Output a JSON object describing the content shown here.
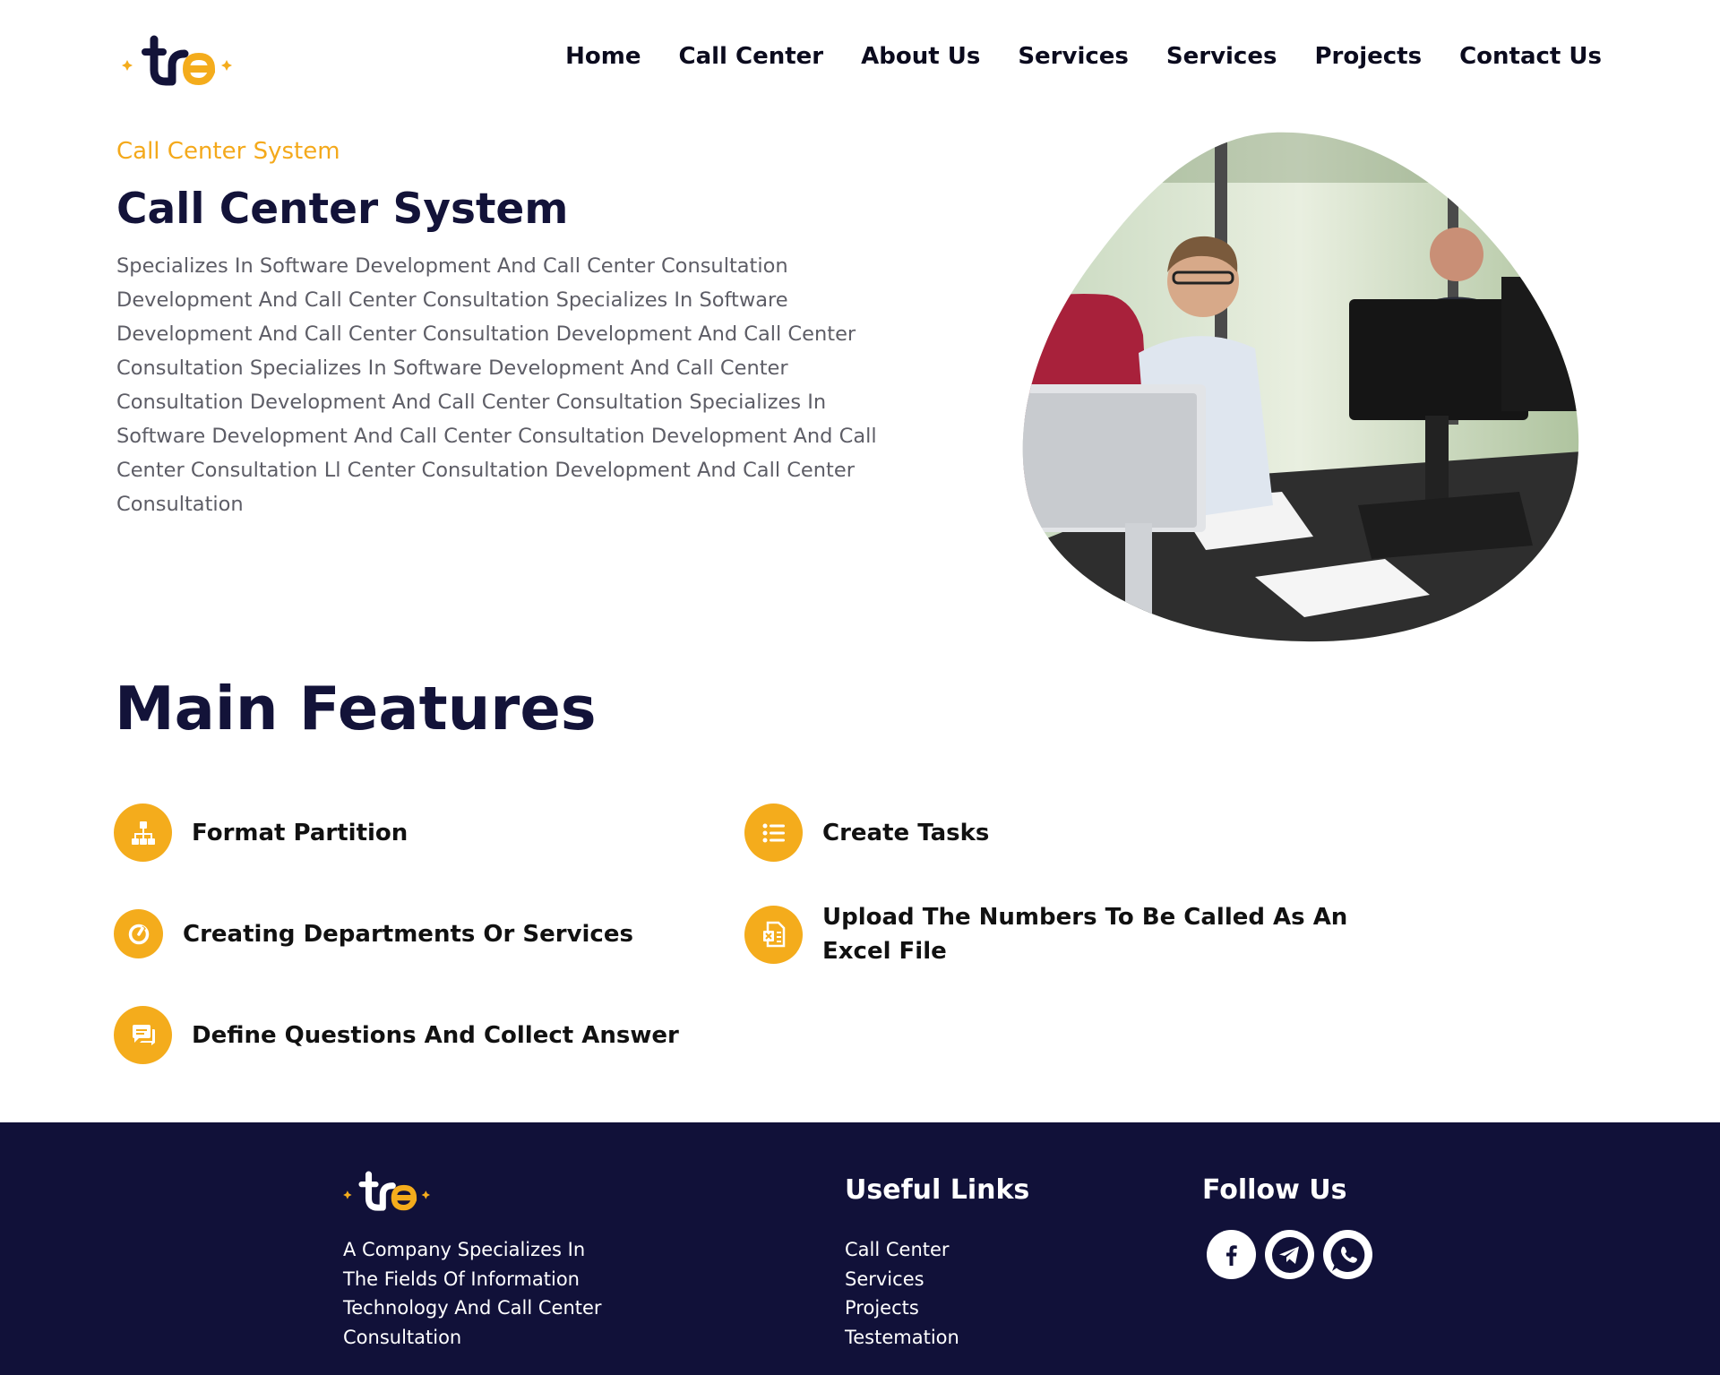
{
  "header": {
    "logo_icon": "tre-logo-icon",
    "nav": [
      {
        "label": "Home"
      },
      {
        "label": "Call Center"
      },
      {
        "label": "About Us"
      },
      {
        "label": "Services"
      },
      {
        "label": "Services"
      },
      {
        "label": "Projects"
      },
      {
        "label": "Contact Us"
      }
    ]
  },
  "hero": {
    "eyebrow": "Call Center System",
    "title": "Call Center System",
    "description": "Specializes In Software Development And Call Center Consultation Development And Call Center Consultation Specializes In Software Development And Call Center Consultation Development And Call Center Consultation Specializes In Software Development And Call Center Consultation Development And Call Center Consultation Specializes In Software Development And Call Center Consultation Development And Call Center Consultation Ll Center Consultation Development And Call Center Consultation",
    "image": "office-workers-at-computers-photo"
  },
  "features": {
    "title": "Main Features",
    "items": [
      {
        "label": "Format Partition",
        "icon": "sitemap-icon"
      },
      {
        "label": "Create Tasks",
        "icon": "list-icon"
      },
      {
        "label": "Creating Departments Or Services",
        "icon": "pie-chart-icon"
      },
      {
        "label": "Upload The Numbers To Be Called As An Excel File",
        "icon": "excel-file-icon"
      },
      {
        "label": "Define Questions And Collect Answer",
        "icon": "chat-icon"
      }
    ]
  },
  "footer": {
    "about": "A Company Specializes In The Fields Of Information Technology And Call Center Consultation",
    "links_heading": "Useful Links",
    "links": [
      "Call Center",
      "Services",
      "Projects",
      "Testemation"
    ],
    "follow_heading": "Follow Us",
    "socials": [
      "facebook-icon",
      "telegram-icon",
      "whatsapp-icon"
    ]
  },
  "colors": {
    "accent": "#f4ac1c",
    "navy": "#131339",
    "footer_bg": "#111139",
    "body_text": "#5d5d66"
  }
}
